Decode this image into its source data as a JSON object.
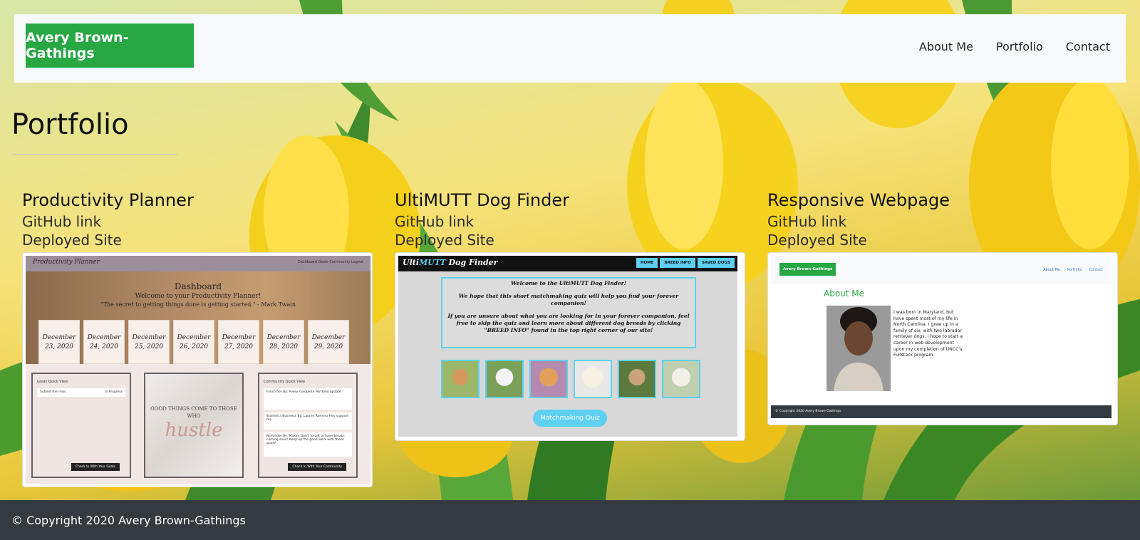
{
  "nav": {
    "brand": "Avery Brown-Gathings",
    "links": [
      "About Me",
      "Portfolio",
      "Contact"
    ]
  },
  "page": {
    "title": "Portfolio"
  },
  "projects": [
    {
      "title": "Productivity Planner",
      "github": "GitHub link",
      "deployed": "Deployed Site",
      "preview": {
        "brand": "Productivity Planner",
        "links": "Dashboard   Goals   Community   Logout",
        "heading": "Dashboard",
        "welcome": "Welcome to your Productivity Planner!",
        "quote": "\"The secret to getting things done is getting started.\" - Mark Twain",
        "days": [
          "December 23, 2020",
          "December 24, 2020",
          "December 25, 2020",
          "December 26, 2020",
          "December 27, 2020",
          "December 28, 2020",
          "December 29, 2020"
        ],
        "goals_title": "Goals Quick View",
        "goal_item": "Submit the links",
        "goal_status": "In Progress",
        "goals_button": "Check In With Your Goals",
        "motivation": "GOOD THINGS COME TO THOSE WHO",
        "hustle": "hustle",
        "community_title": "Community Quick View",
        "community_items": [
          "Finish her  By: Avery  Complete Portfolio update",
          "Started a Business  By: Lauren Romero  Hey support me",
          "Reminder  By: Maxim  Don't forget to have breaks coming soon! Keep up the good work with those goals!"
        ],
        "community_button": "Check In With Your Community"
      }
    },
    {
      "title": "UltiMUTT Dog Finder",
      "github": "GitHub link",
      "deployed": "Deployed Site",
      "preview": {
        "brand_a": "Ulti",
        "brand_b": "MUTT",
        "brand_c": " Dog Finder",
        "tabs": [
          "HOME",
          "BREED INFO",
          "SAVED DOGS"
        ],
        "welcome_1": "Welcome to the UltiMUTT Dog Finder!",
        "welcome_2": "We hope that this short matchmaking quiz will help you find your forever companion!",
        "welcome_3": "If you are unsure about what you are looking for in your forever companion, feel free to skip the quiz and learn more about different dog breeds by clicking \"BREED INFO\" found in the top right corner of our site!",
        "quiz_button": "Matchmaking Quiz"
      }
    },
    {
      "title": "Responsive Webpage",
      "github": "GitHub link",
      "deployed": "Deployed Site",
      "preview": {
        "brand": "Avery Brown-Gathings",
        "links": [
          "About Me",
          "Portfolio",
          "Contact"
        ],
        "heading": "About Me",
        "bio": "I was born in Maryland, but have spent most of my life in North Carolina. I grew up in a family of six, with two labrador retriever dogs. I hope to start a career in web development upon my completion of UNCC's Fullstack program.",
        "footer": "© Copyright 2020 Avery Brown-Gathings"
      }
    }
  ],
  "footer": {
    "copyright": "© Copyright 2020 Avery Brown-Gathings"
  },
  "colors": {
    "brand": "#28a745",
    "footer": "#343a40",
    "navbar": "#f8f9fa",
    "dogfinder_accent": "#5ed0f2"
  }
}
